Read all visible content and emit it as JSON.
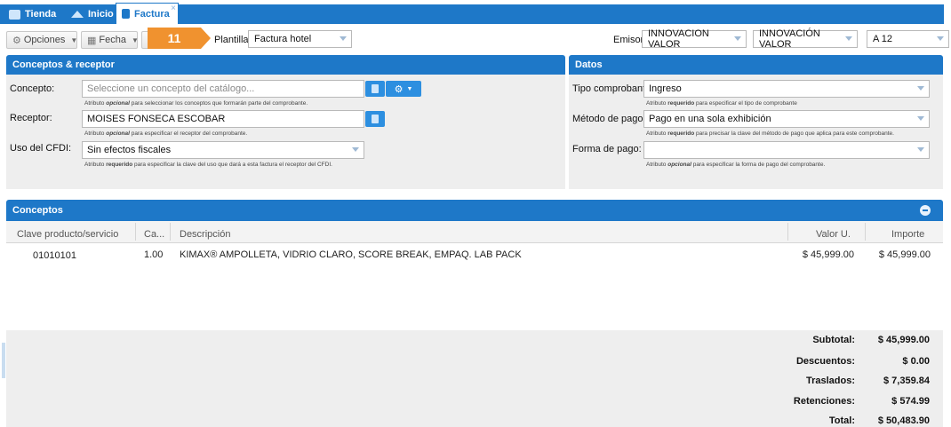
{
  "tabs": [
    {
      "label": "Tienda"
    },
    {
      "label": "Inicio"
    },
    {
      "label": "Factura"
    }
  ],
  "toolbar": {
    "opciones_label": "Opciones",
    "fecha_label": "Fecha",
    "step_badge": "11",
    "plantilla_label": "Plantilla:",
    "plantilla_value": "Factura hotel",
    "emisor_label": "Emisor",
    "emisor_value1": "INNOVACION VALOR",
    "emisor_value2": "INNOVACIÓN VALOR",
    "emisor_value3": "A 12"
  },
  "conceptos_receptor": {
    "title": "Conceptos & receptor",
    "concepto_label": "Concepto:",
    "concepto_placeholder": "Seleccione un concepto del catálogo...",
    "concepto_hint_a": "Atributo ",
    "concepto_hint_b": "opcional",
    "concepto_hint_c": " para seleccionar los conceptos que formarán parte del comprobante.",
    "receptor_label": "Receptor:",
    "receptor_value": "MOISES FONSECA ESCOBAR",
    "receptor_hint_a": "Atributo ",
    "receptor_hint_b": "opcional",
    "receptor_hint_c": " para especificar el receptor del comprobante.",
    "uso_label": "Uso del CFDI:",
    "uso_value": "Sin efectos fiscales",
    "uso_hint_a": "Atributo ",
    "uso_hint_b": "requerido",
    "uso_hint_c": " para especificar la clave del uso que dará a esta factura el receptor del CFDI."
  },
  "datos": {
    "title": "Datos",
    "tipo_label": "Tipo comprobante:",
    "tipo_value": "Ingreso",
    "tipo_hint_a": "Atributo ",
    "tipo_hint_b": "requerido",
    "tipo_hint_c": " para especificar el tipo de comprobante",
    "metodo_label": "Método de pago:",
    "metodo_value": "Pago en una sola exhibición",
    "metodo_hint_a": "Atributo ",
    "metodo_hint_b": "requerido",
    "metodo_hint_c": " para precisar la clave del método de pago que aplica para este comprobante.",
    "forma_label": "Forma de pago:",
    "forma_value": "",
    "forma_hint_a": "Atributo ",
    "forma_hint_b": "opcional",
    "forma_hint_c": " para especificar la forma de pago del comprobante."
  },
  "conceptos": {
    "title": "Conceptos",
    "columns": [
      "Clave producto/servicio",
      "Ca...",
      "Descripción",
      "Valor U.",
      "Importe"
    ],
    "rows": [
      {
        "clave": "01010101",
        "cantidad": "1.00",
        "descripcion": "KIMAX® AMPOLLETA, VIDRIO CLARO, SCORE BREAK, EMPAQ. LAB PACK",
        "valor": "$ 45,999.00",
        "importe": "$ 45,999.00"
      }
    ]
  },
  "totals": {
    "subtotal_label": "Subtotal:",
    "subtotal": "$ 45,999.00",
    "descuentos_label": "Descuentos:",
    "descuentos": "$ 0.00",
    "traslados_label": "Traslados:",
    "traslados": "$ 7,359.84",
    "retenciones_label": "Retenciones:",
    "retenciones": "$ 574.99",
    "total_label": "Total:",
    "total": "$ 50,483.90"
  },
  "colors": {
    "accent": "#1e78c8",
    "badge": "#f0922f"
  },
  "icons": [
    "window-icon",
    "home-icon",
    "document-icon",
    "close-icon",
    "gear-icon",
    "calendar-icon",
    "collapse-icon"
  ]
}
